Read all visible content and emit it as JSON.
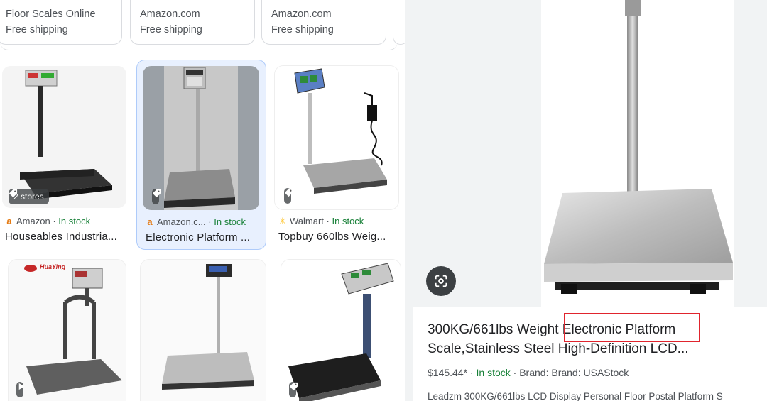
{
  "top_cards": [
    {
      "line1": "Floor Scales Online",
      "line2": "Free shipping"
    },
    {
      "line1": "Amazon.com",
      "line2": "Free shipping"
    },
    {
      "line1": "Amazon.com",
      "line2": "Free shipping"
    }
  ],
  "results": [
    {
      "store_badge": "2 stores",
      "source": "Amazon",
      "stock": "In stock",
      "title": "Houseables Industria..."
    },
    {
      "source": "Amazon.c...",
      "stock": "In stock",
      "title": "Electronic Platform ..."
    },
    {
      "source": "Walmart",
      "stock": "In stock",
      "title": "Topbuy 660lbs Weig..."
    }
  ],
  "row2_brand": "HuaYing",
  "detail": {
    "title_before": "300KG/661lbs Weight ",
    "title_highlight": "Electronic Platform",
    "title_after": " Scale,Stainless Steel High-Definition LCD...",
    "price": "$145.44*",
    "stock": "In stock",
    "brand": "Brand: Brand: USAStock",
    "description": "Leadzm 300KG/661lbs LCD Display Personal Floor Postal Platform S"
  },
  "separator": "·",
  "colors": {
    "in_stock": "#188038",
    "highlight_box": "#e0242d",
    "selected_card": "#e8f0fe"
  }
}
